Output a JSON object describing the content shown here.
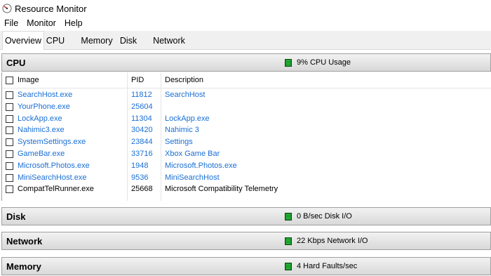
{
  "window": {
    "title": "Resource Monitor"
  },
  "menu": [
    "File",
    "Monitor",
    "Help"
  ],
  "tabs": [
    "Overview",
    "CPU",
    "Memory",
    "Disk",
    "Network"
  ],
  "cpu": {
    "title": "CPU",
    "status": "9% CPU Usage",
    "columns": {
      "image": "Image",
      "pid": "PID",
      "description": "Description"
    },
    "rows": [
      {
        "image": "SearchHost.exe",
        "pid": "11812",
        "description": "SearchHost",
        "highlight": true
      },
      {
        "image": "YourPhone.exe",
        "pid": "25604",
        "description": "",
        "highlight": true
      },
      {
        "image": "LockApp.exe",
        "pid": "11304",
        "description": "LockApp.exe",
        "highlight": true
      },
      {
        "image": "Nahimic3.exe",
        "pid": "30420",
        "description": "Nahimic 3",
        "highlight": true
      },
      {
        "image": "SystemSettings.exe",
        "pid": "23844",
        "description": "Settings",
        "highlight": true
      },
      {
        "image": "GameBar.exe",
        "pid": "33716",
        "description": "Xbox Game Bar",
        "highlight": true
      },
      {
        "image": "Microsoft.Photos.exe",
        "pid": "1948",
        "description": "Microsoft.Photos.exe",
        "highlight": true
      },
      {
        "image": "MiniSearchHost.exe",
        "pid": "9536",
        "description": "MiniSearchHost",
        "highlight": true
      },
      {
        "image": "CompatTelRunner.exe",
        "pid": "25668",
        "description": "Microsoft Compatibility Telemetry",
        "highlight": false
      }
    ]
  },
  "disk": {
    "title": "Disk",
    "status": "0 B/sec Disk I/O"
  },
  "network": {
    "title": "Network",
    "status": "22 Kbps Network I/O"
  },
  "memory": {
    "title": "Memory",
    "status": "4 Hard Faults/sec"
  },
  "colors": {
    "link": "#1a6fd4",
    "gauge": "#1a8f2a"
  }
}
